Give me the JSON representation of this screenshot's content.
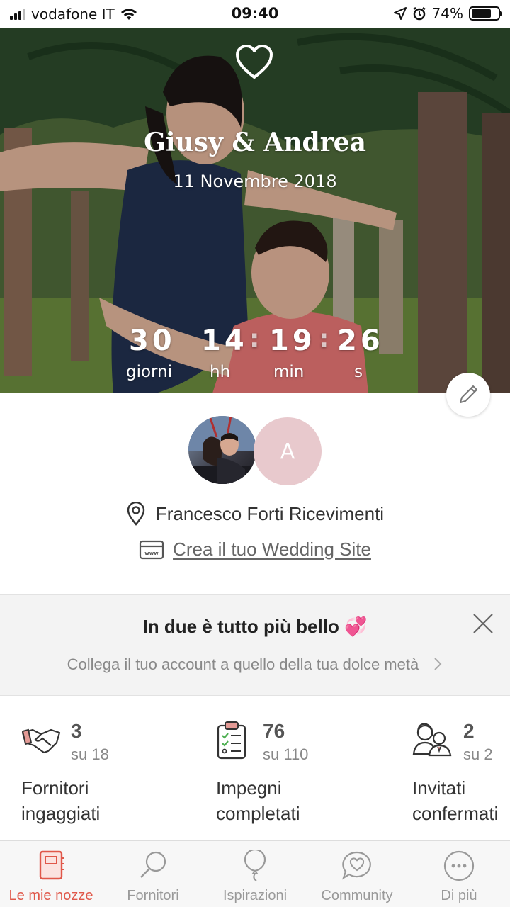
{
  "status_bar": {
    "carrier": "vodafone IT",
    "time": "09:40",
    "battery": "74%",
    "battery_level": 0.74
  },
  "hero": {
    "couple_names": "Giusy & Andrea",
    "wedding_date": "11 Novembre 2018",
    "countdown": {
      "days": "30",
      "hours": "14",
      "minutes": "19",
      "seconds": "26",
      "days_label": "giorni",
      "hours_label": "hh",
      "minutes_label": "min",
      "seconds_label": "s"
    }
  },
  "profile": {
    "partner_initial": "A",
    "venue": "Francesco Forti Ricevimenti",
    "website_link": "Crea il tuo Wedding Site"
  },
  "banner": {
    "title": "In due è tutto più bello 💞",
    "subtitle": "Collega il tuo account a quello della tua dolce metà"
  },
  "stats": [
    {
      "value": "3",
      "total": "su 18",
      "label_line1": "Fornitori",
      "label_line2": "ingaggiati",
      "icon": "handshake-icon"
    },
    {
      "value": "76",
      "total": "su 110",
      "label_line1": "Impegni",
      "label_line2": "completati",
      "icon": "checklist-icon"
    },
    {
      "value": "2",
      "total": "su 2",
      "label_line1": "Invitati",
      "label_line2": "confermati",
      "icon": "guests-icon"
    }
  ],
  "tabs": [
    {
      "label": "Le mie nozze",
      "icon": "notebook-icon",
      "active": true
    },
    {
      "label": "Fornitori",
      "icon": "search-icon",
      "active": false
    },
    {
      "label": "Ispirazioni",
      "icon": "balloon-icon",
      "active": false
    },
    {
      "label": "Community",
      "icon": "chat-heart-icon",
      "active": false
    },
    {
      "label": "Di più",
      "icon": "more-icon",
      "active": false
    }
  ],
  "colors": {
    "accent": "#e0584a",
    "avatar_initial_bg": "#e8c9cd",
    "banner_bg": "#f3f3f3"
  }
}
